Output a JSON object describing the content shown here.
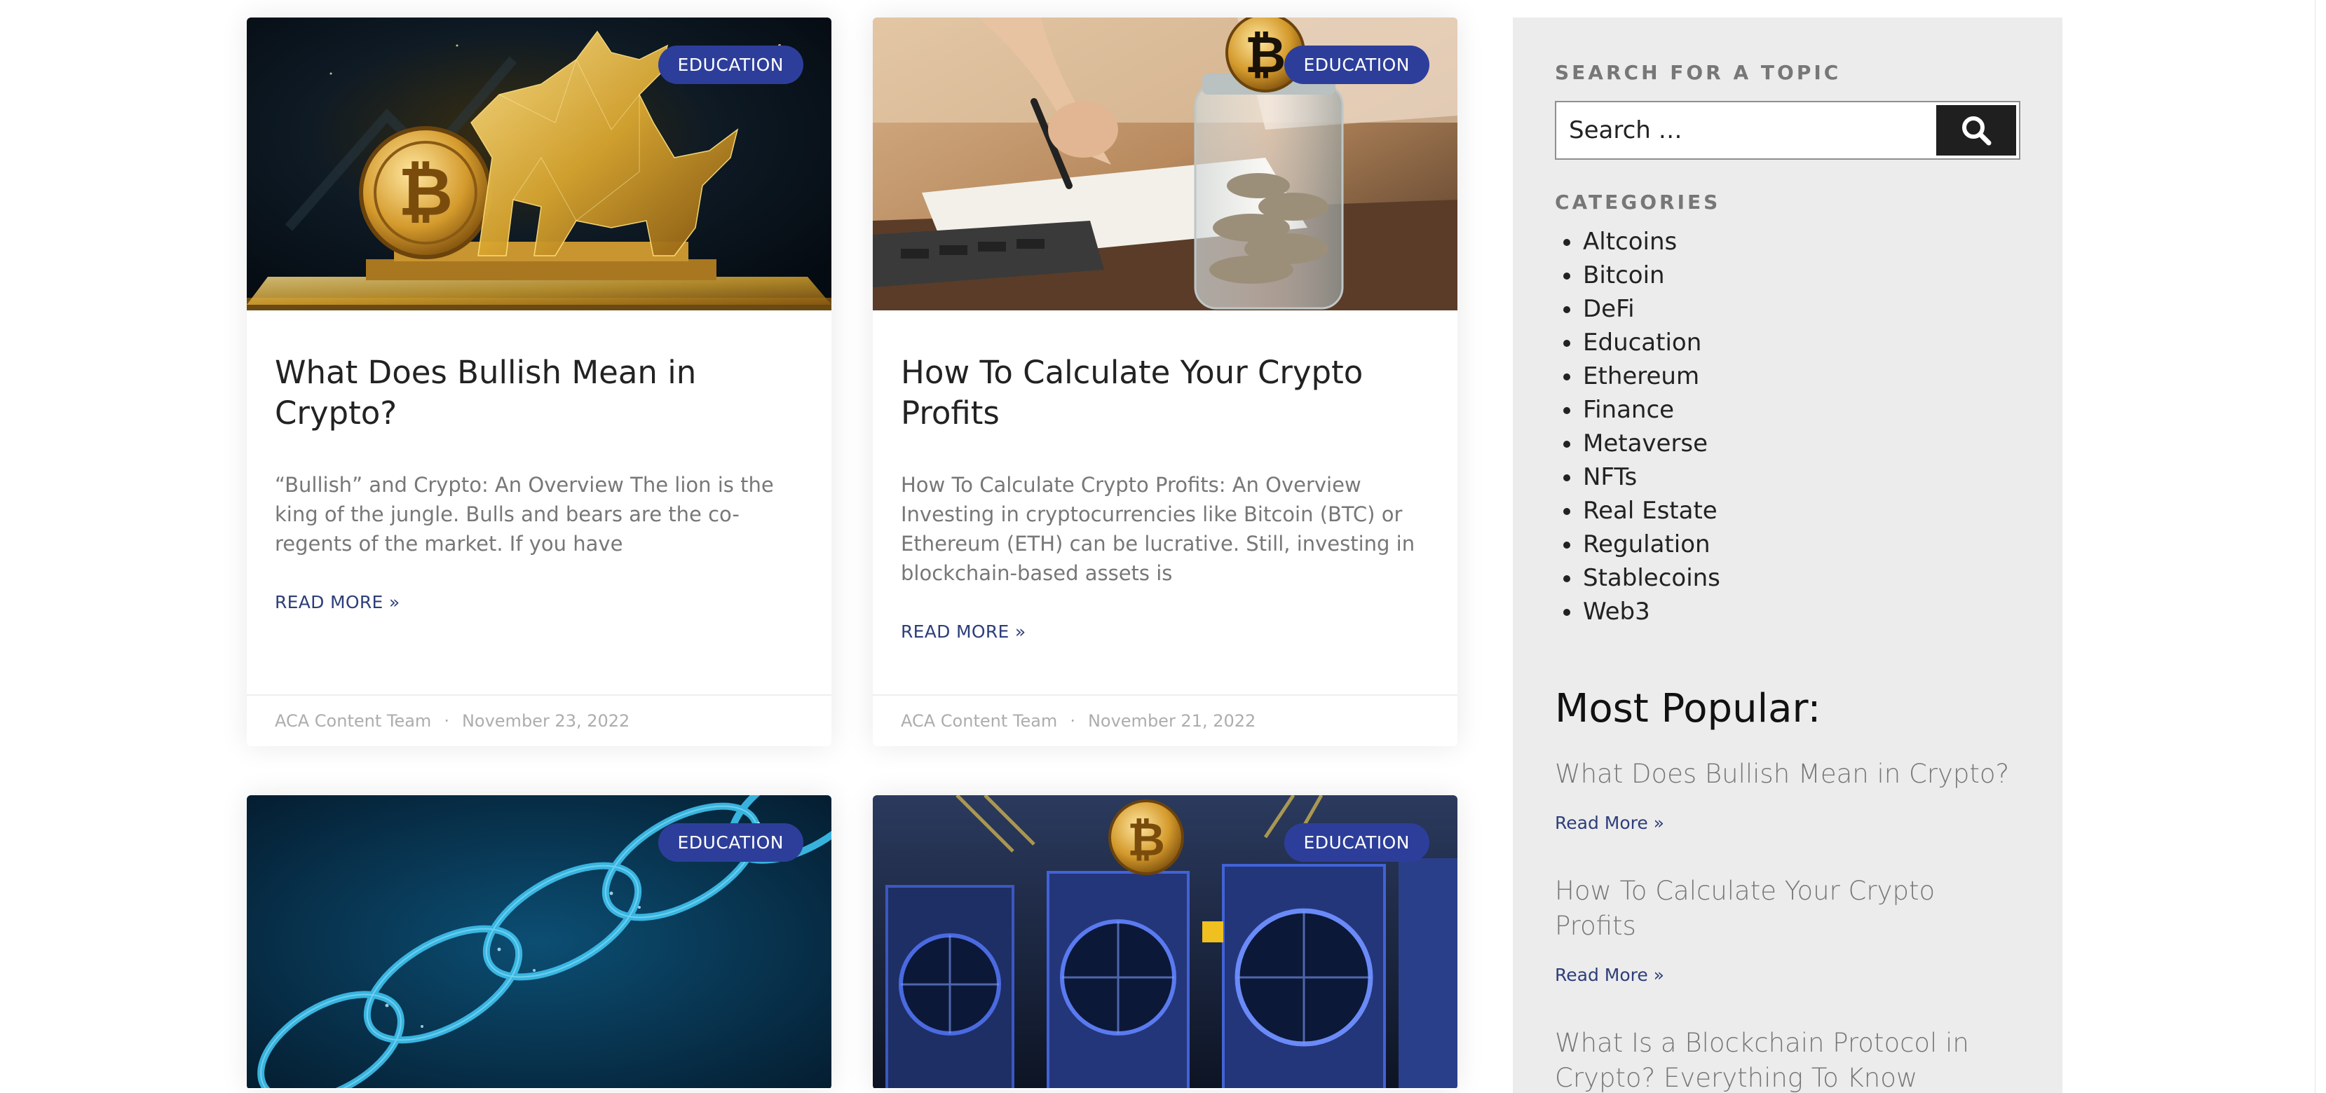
{
  "posts": [
    {
      "category": "EDUCATION",
      "title": "What Does Bullish Mean in Crypto?",
      "excerpt": "“Bullish” and Crypto: An Overview The lion is the king of the jungle. Bulls and bears are the co-regents of the market. If you have",
      "read_more": "READ MORE »",
      "author": "ACA Content Team",
      "separator": "·",
      "date": "November 23, 2022",
      "image_icon": "golden-bull-bitcoin-image"
    },
    {
      "category": "EDUCATION",
      "title": "How To Calculate Your Crypto Profits",
      "excerpt": "How To Calculate Crypto Profits: An Overview Investing in cryptocurrencies like Bitcoin (BTC) or Ethereum (ETH) can be lucrative. Still, investing in blockchain-based assets is",
      "read_more": "READ MORE »",
      "author": "ACA Content Team",
      "separator": "·",
      "date": "November 21, 2022",
      "image_icon": "coin-jar-calculator-image"
    },
    {
      "category": "EDUCATION",
      "image_icon": "blue-blockchain-chain-image"
    },
    {
      "category": "EDUCATION",
      "image_icon": "mining-rig-bitcoin-image"
    }
  ],
  "sidebar": {
    "search_heading": "SEARCH FOR A TOPIC",
    "search_placeholder": "Search …",
    "search_icon": "search-icon",
    "categories_heading": "CATEGORIES",
    "categories": [
      "Altcoins",
      "Bitcoin",
      "DeFi",
      "Education",
      "Ethereum",
      "Finance",
      "Metaverse",
      "NFTs",
      "Real Estate",
      "Regulation",
      "Stablecoins",
      "Web3"
    ],
    "popular_heading": "Most Popular:",
    "popular": [
      {
        "title": "What Does Bullish Mean in Crypto?",
        "read_more": "Read More »"
      },
      {
        "title": "How To Calculate Your Crypto Profits",
        "read_more": "Read More »"
      },
      {
        "title": "What Is a Blockchain Protocol in Crypto? Everything To Know",
        "read_more": ""
      }
    ]
  },
  "colors": {
    "badge": "#2d3e9a",
    "link": "#2d3e7a",
    "sidebar_bg": "#ececec"
  }
}
